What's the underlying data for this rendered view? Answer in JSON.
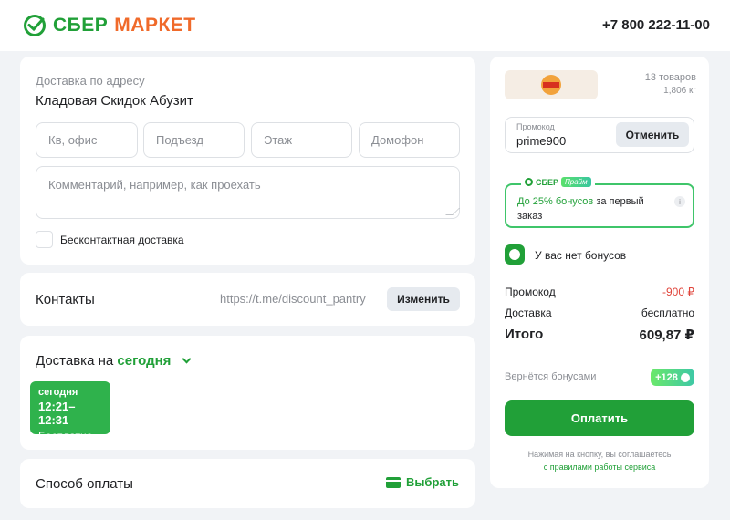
{
  "header": {
    "brand_sber": "СБЕР",
    "brand_market": "МАРКЕТ",
    "phone": "+7 800 222-11-00"
  },
  "address": {
    "caption": "Доставка по адресу",
    "value": "Кладовая Скидок Абузит",
    "fields": [
      {
        "placeholder": "Кв, офис"
      },
      {
        "placeholder": "Подъезд"
      },
      {
        "placeholder": "Этаж"
      },
      {
        "placeholder": "Домофон"
      }
    ],
    "comment_placeholder": "Комментарий, например, как проехать",
    "contactless_label": "Бесконтактная доставка"
  },
  "contacts": {
    "title": "Контакты",
    "value": "https://t.me/discount_pantry",
    "change_label": "Изменить"
  },
  "delivery": {
    "title_prefix": "Доставка на",
    "title_day": "сегодня",
    "slot": {
      "day": "сегодня",
      "time": "12:21–12:31",
      "price": "Бесплатно"
    }
  },
  "payment": {
    "title": "Способ оплаты",
    "choose_label": "Выбрать"
  },
  "order": {
    "store_logo": "burger-king-logo",
    "items_count": "13 товаров",
    "weight": "1,806 кг",
    "promo_label": "Промокод",
    "promo_code": "prime900",
    "promo_cancel": "Отменить",
    "prime": {
      "brand": "СБЕР",
      "badge": "Прайм",
      "text_lead": "До 25% бонусов",
      "text_rest": "за первый заказ"
    },
    "bonus_text": "У вас нет бонусов",
    "summary": [
      {
        "label": "Промокод",
        "value": "-900 ₽"
      },
      {
        "label": "Доставка",
        "value": "бесплатно"
      }
    ],
    "total_label": "Итого",
    "total_value": "609,87 ₽",
    "bonus_return_label": "Вернётся бонусами",
    "bonus_return_value": "+128",
    "pay_label": "Оплатить",
    "legal_text": "Нажимая на кнопку, вы соглашаетесь",
    "legal_link": "с правилами работы сервиса"
  },
  "colors": {
    "accent": "#21a038",
    "brand_orange": "#f06a2a",
    "discount": "#e0453b",
    "background": "#f1f3f6"
  }
}
